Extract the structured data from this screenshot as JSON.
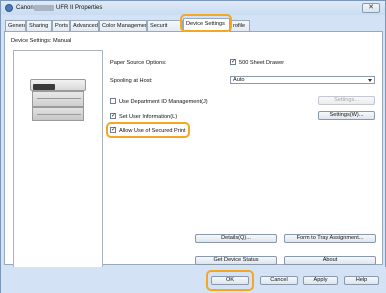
{
  "window": {
    "title_start": "Canon",
    "title_end": "UFR II Properties",
    "close_glyph": "✕"
  },
  "tabs": [
    {
      "label": "General"
    },
    {
      "label": "Sharing"
    },
    {
      "label": "Ports"
    },
    {
      "label": "Advanced"
    },
    {
      "label": "Color Management"
    },
    {
      "label": "Securit"
    },
    {
      "label": "Device Settings"
    },
    {
      "label": "rofile"
    }
  ],
  "panel": {
    "title": "Device Settings: Manual"
  },
  "settings": {
    "paper_source_label": "Paper Source Options:",
    "paper_source_checkbox_label": "500 Sheet Drawer",
    "spooling_label": "Spooling at Host:",
    "spooling_value": "Auto",
    "dept_id_label": "Use Department ID Management(J)",
    "user_info_label": "Set User Information(L)",
    "secured_print_label": "Allow Use of Secured Print",
    "settings_button": "Settings...",
    "settings_w_button": "Settings(W)..."
  },
  "actions": {
    "details": "Details(Q)...",
    "form_to_tray": "Form to Tray Assignment...",
    "get_device_status": "Get Device Status",
    "about": "About"
  },
  "dialog_buttons": {
    "ok": "OK",
    "cancel": "Cancel",
    "apply": "Apply",
    "help": "Help"
  },
  "check_glyph": "✓",
  "colors": {
    "highlight": "#f5a623",
    "window_bg": "#d3e3f5"
  }
}
